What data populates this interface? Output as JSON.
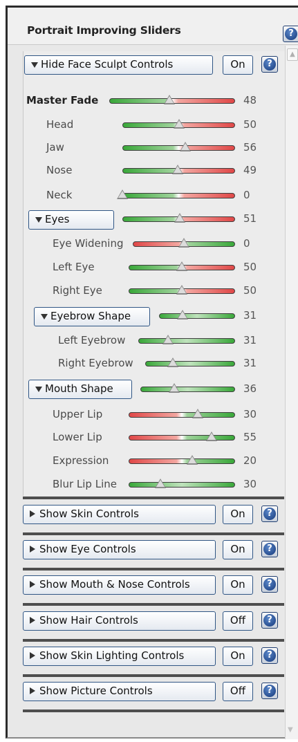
{
  "panel": {
    "title": "Portrait Improving Sliders",
    "help_glyph": "?"
  },
  "face_sculpt": {
    "toggle_label": "Hide Face Sculpt Controls",
    "state": "On",
    "sliders": [
      {
        "label": "Master Fade",
        "value": "48",
        "fraction": 0.48,
        "gradient": "green-red"
      },
      {
        "label": "Head",
        "value": "50",
        "fraction": 0.5,
        "gradient": "green-red"
      },
      {
        "label": "Jaw",
        "value": "56",
        "fraction": 0.56,
        "gradient": "green-red"
      },
      {
        "label": "Nose",
        "value": "49",
        "fraction": 0.49,
        "gradient": "green-red"
      },
      {
        "label": "Neck",
        "value": "0",
        "fraction": 0.0,
        "gradient": "green-red"
      }
    ],
    "eyes": {
      "toggle_label": "Eyes",
      "value": "51",
      "fraction": 0.51,
      "sliders": [
        {
          "label": "Eye Widening",
          "value": "0",
          "fraction": 0.5,
          "gradient": "red-green"
        },
        {
          "label": "Left Eye",
          "value": "50",
          "fraction": 0.5,
          "gradient": "green-red"
        },
        {
          "label": "Right Eye",
          "value": "50",
          "fraction": 0.5,
          "gradient": "green-red"
        }
      ]
    },
    "eyebrow_shape": {
      "toggle_label": "Eyebrow Shape",
      "value": "31",
      "fraction": 0.31,
      "sliders": [
        {
          "label": "Left Eyebrow",
          "value": "31",
          "fraction": 0.31,
          "gradient": "green"
        },
        {
          "label": "Right Eyebrow",
          "value": "31",
          "fraction": 0.31,
          "gradient": "green"
        }
      ]
    },
    "mouth_shape": {
      "toggle_label": "Mouth Shape",
      "value": "36",
      "fraction": 0.36,
      "sliders": [
        {
          "label": "Upper Lip",
          "value": "30",
          "fraction": 0.65,
          "gradient": "red-green"
        },
        {
          "label": "Lower Lip",
          "value": "55",
          "fraction": 0.78,
          "gradient": "red-green"
        },
        {
          "label": "Expression",
          "value": "20",
          "fraction": 0.6,
          "gradient": "red-green"
        },
        {
          "label": "Blur Lip Line",
          "value": "30",
          "fraction": 0.3,
          "gradient": "green"
        }
      ]
    }
  },
  "collapsed_sections": [
    {
      "label": "Show Skin Controls",
      "state": "On"
    },
    {
      "label": "Show Eye Controls",
      "state": "On"
    },
    {
      "label": "Show Mouth & Nose Controls",
      "state": "On"
    },
    {
      "label": "Show Hair Controls",
      "state": "Off"
    },
    {
      "label": "Show Skin Lighting Controls",
      "state": "On"
    },
    {
      "label": "Show Picture Controls",
      "state": "Off"
    }
  ],
  "colors": {
    "button_border": "#2f5584",
    "help_blue": "#14387a",
    "slider_green": "#48b848",
    "slider_red": "#e04848",
    "divider": "#4e4e4e"
  }
}
